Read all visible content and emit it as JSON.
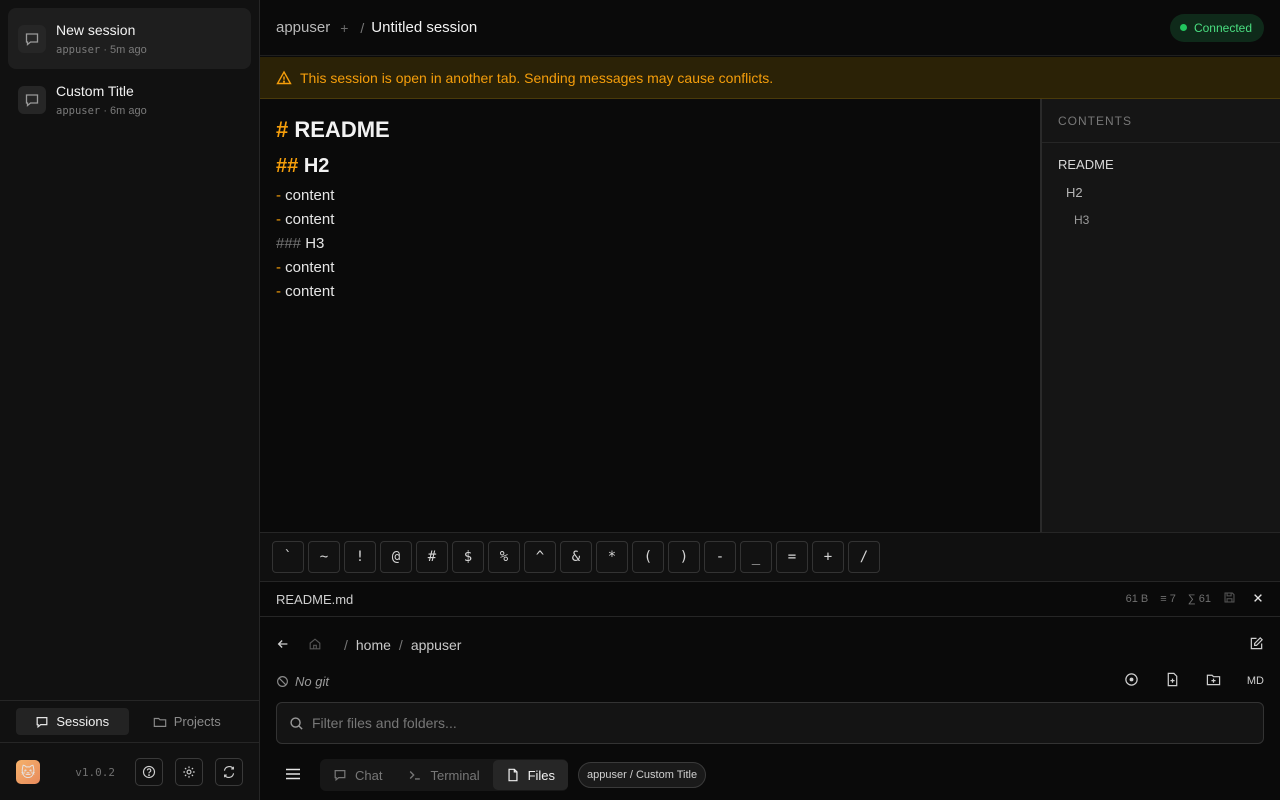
{
  "sidebar": {
    "sessions": [
      {
        "title": "New session",
        "user": "appuser",
        "time": "· 5m ago"
      },
      {
        "title": "Custom Title",
        "user": "appuser",
        "time": "· 6m ago"
      }
    ],
    "tabs": [
      "Sessions",
      "Projects"
    ],
    "version": "v1.0.2"
  },
  "header": {
    "user": "appuser",
    "plus": "+",
    "separator": "/",
    "session_title": "Untitled session",
    "status": "Connected"
  },
  "warning": "This session is open in another tab. Sending messages may cause conflicts.",
  "editor": {
    "h1_hash": "#",
    "h1_text": "README",
    "h2_hash": "##",
    "h2_text": "H2",
    "dash": "-",
    "content": "content",
    "h3_hash": "###",
    "h3_text": "H3"
  },
  "toc": {
    "heading": "CONTENTS",
    "items": [
      "README",
      "H2",
      "H3"
    ]
  },
  "symbols": [
    "`",
    "~",
    "!",
    "@",
    "#",
    "$",
    "%",
    "^",
    "&",
    "*",
    "(",
    ")",
    "-",
    "_",
    "=",
    "+",
    "/"
  ],
  "file": {
    "name": "README.md",
    "size": "61 B",
    "lines": "≡ 7",
    "chars": "∑ 61"
  },
  "path": {
    "sep": "/",
    "segments": [
      "home",
      "appuser"
    ]
  },
  "git": {
    "status": "No git",
    "md_label": "MD"
  },
  "filter": {
    "placeholder": "Filter files and folders..."
  },
  "bottom_nav": {
    "tabs": [
      "Chat",
      "Terminal",
      "Files"
    ],
    "context_pill": "appuser / Custom Title"
  },
  "colors": {
    "accent": "#f59e0b",
    "connected": "#22c55e",
    "background": "#0a0a0a"
  }
}
